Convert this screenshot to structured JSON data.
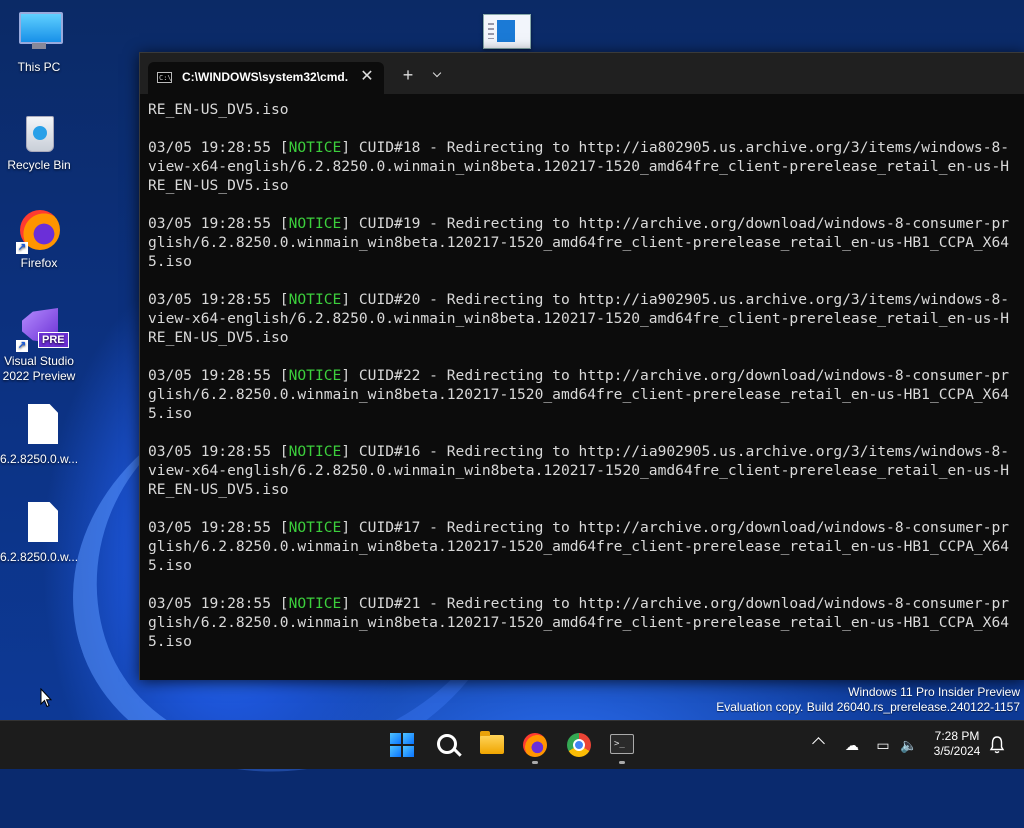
{
  "desktop": {
    "icons": [
      {
        "label": "This PC"
      },
      {
        "label": "Recycle Bin"
      },
      {
        "label": "Firefox"
      },
      {
        "label": "Visual Studio 2022 Preview",
        "badge": "PRE"
      },
      {
        "label": "6.2.8250.0.w..."
      },
      {
        "label": "6.2.8250.0.w..."
      }
    ]
  },
  "terminal": {
    "tab_title": "C:\\WINDOWS\\system32\\cmd.",
    "close_glyph": "✕",
    "new_tab_glyph": "+",
    "lines": [
      {
        "text": "RE_EN-US_DV5.iso"
      },
      {
        "text": ""
      },
      {
        "pre": "03/05 19:28:55 [",
        "tag": "NOTICE",
        "post": "] CUID#18 - Redirecting to http://ia802905.us.archive.org/3/items/windows-8-"
      },
      {
        "text": "view-x64-english/6.2.8250.0.winmain_win8beta.120217-1520_amd64fre_client-prerelease_retail_en-us-H"
      },
      {
        "text": "RE_EN-US_DV5.iso"
      },
      {
        "text": ""
      },
      {
        "pre": "03/05 19:28:55 [",
        "tag": "NOTICE",
        "post": "] CUID#19 - Redirecting to http://archive.org/download/windows-8-consumer-pr"
      },
      {
        "text": "glish/6.2.8250.0.winmain_win8beta.120217-1520_amd64fre_client-prerelease_retail_en-us-HB1_CCPA_X64"
      },
      {
        "text": "5.iso"
      },
      {
        "text": ""
      },
      {
        "pre": "03/05 19:28:55 [",
        "tag": "NOTICE",
        "post": "] CUID#20 - Redirecting to http://ia902905.us.archive.org/3/items/windows-8-"
      },
      {
        "text": "view-x64-english/6.2.8250.0.winmain_win8beta.120217-1520_amd64fre_client-prerelease_retail_en-us-H"
      },
      {
        "text": "RE_EN-US_DV5.iso"
      },
      {
        "text": ""
      },
      {
        "pre": "03/05 19:28:55 [",
        "tag": "NOTICE",
        "post": "] CUID#22 - Redirecting to http://archive.org/download/windows-8-consumer-pr"
      },
      {
        "text": "glish/6.2.8250.0.winmain_win8beta.120217-1520_amd64fre_client-prerelease_retail_en-us-HB1_CCPA_X64"
      },
      {
        "text": "5.iso"
      },
      {
        "text": ""
      },
      {
        "pre": "03/05 19:28:55 [",
        "tag": "NOTICE",
        "post": "] CUID#16 - Redirecting to http://ia902905.us.archive.org/3/items/windows-8-"
      },
      {
        "text": "view-x64-english/6.2.8250.0.winmain_win8beta.120217-1520_amd64fre_client-prerelease_retail_en-us-H"
      },
      {
        "text": "RE_EN-US_DV5.iso"
      },
      {
        "text": ""
      },
      {
        "pre": "03/05 19:28:55 [",
        "tag": "NOTICE",
        "post": "] CUID#17 - Redirecting to http://archive.org/download/windows-8-consumer-pr"
      },
      {
        "text": "glish/6.2.8250.0.winmain_win8beta.120217-1520_amd64fre_client-prerelease_retail_en-us-HB1_CCPA_X64"
      },
      {
        "text": "5.iso"
      },
      {
        "text": ""
      },
      {
        "pre": "03/05 19:28:55 [",
        "tag": "NOTICE",
        "post": "] CUID#21 - Redirecting to http://archive.org/download/windows-8-consumer-pr"
      },
      {
        "text": "glish/6.2.8250.0.winmain_win8beta.120217-1520_amd64fre_client-prerelease_retail_en-us-HB1_CCPA_X64"
      },
      {
        "text": "5.iso"
      }
    ]
  },
  "watermark": {
    "line1": "Windows 11 Pro Insider Preview",
    "line2": "Evaluation copy. Build 26040.rs_prerelease.240122-1157"
  },
  "taskbar": {
    "apps": [
      "windows-start",
      "search",
      "file-explorer",
      "firefox",
      "chrome",
      "terminal"
    ],
    "clock_time": "7:28 PM",
    "clock_date": "3/5/2024"
  },
  "colors": {
    "notice": "#3ccf3c",
    "console_bg": "#0c0c0c",
    "taskbar_bg": "#1c1c1c"
  }
}
